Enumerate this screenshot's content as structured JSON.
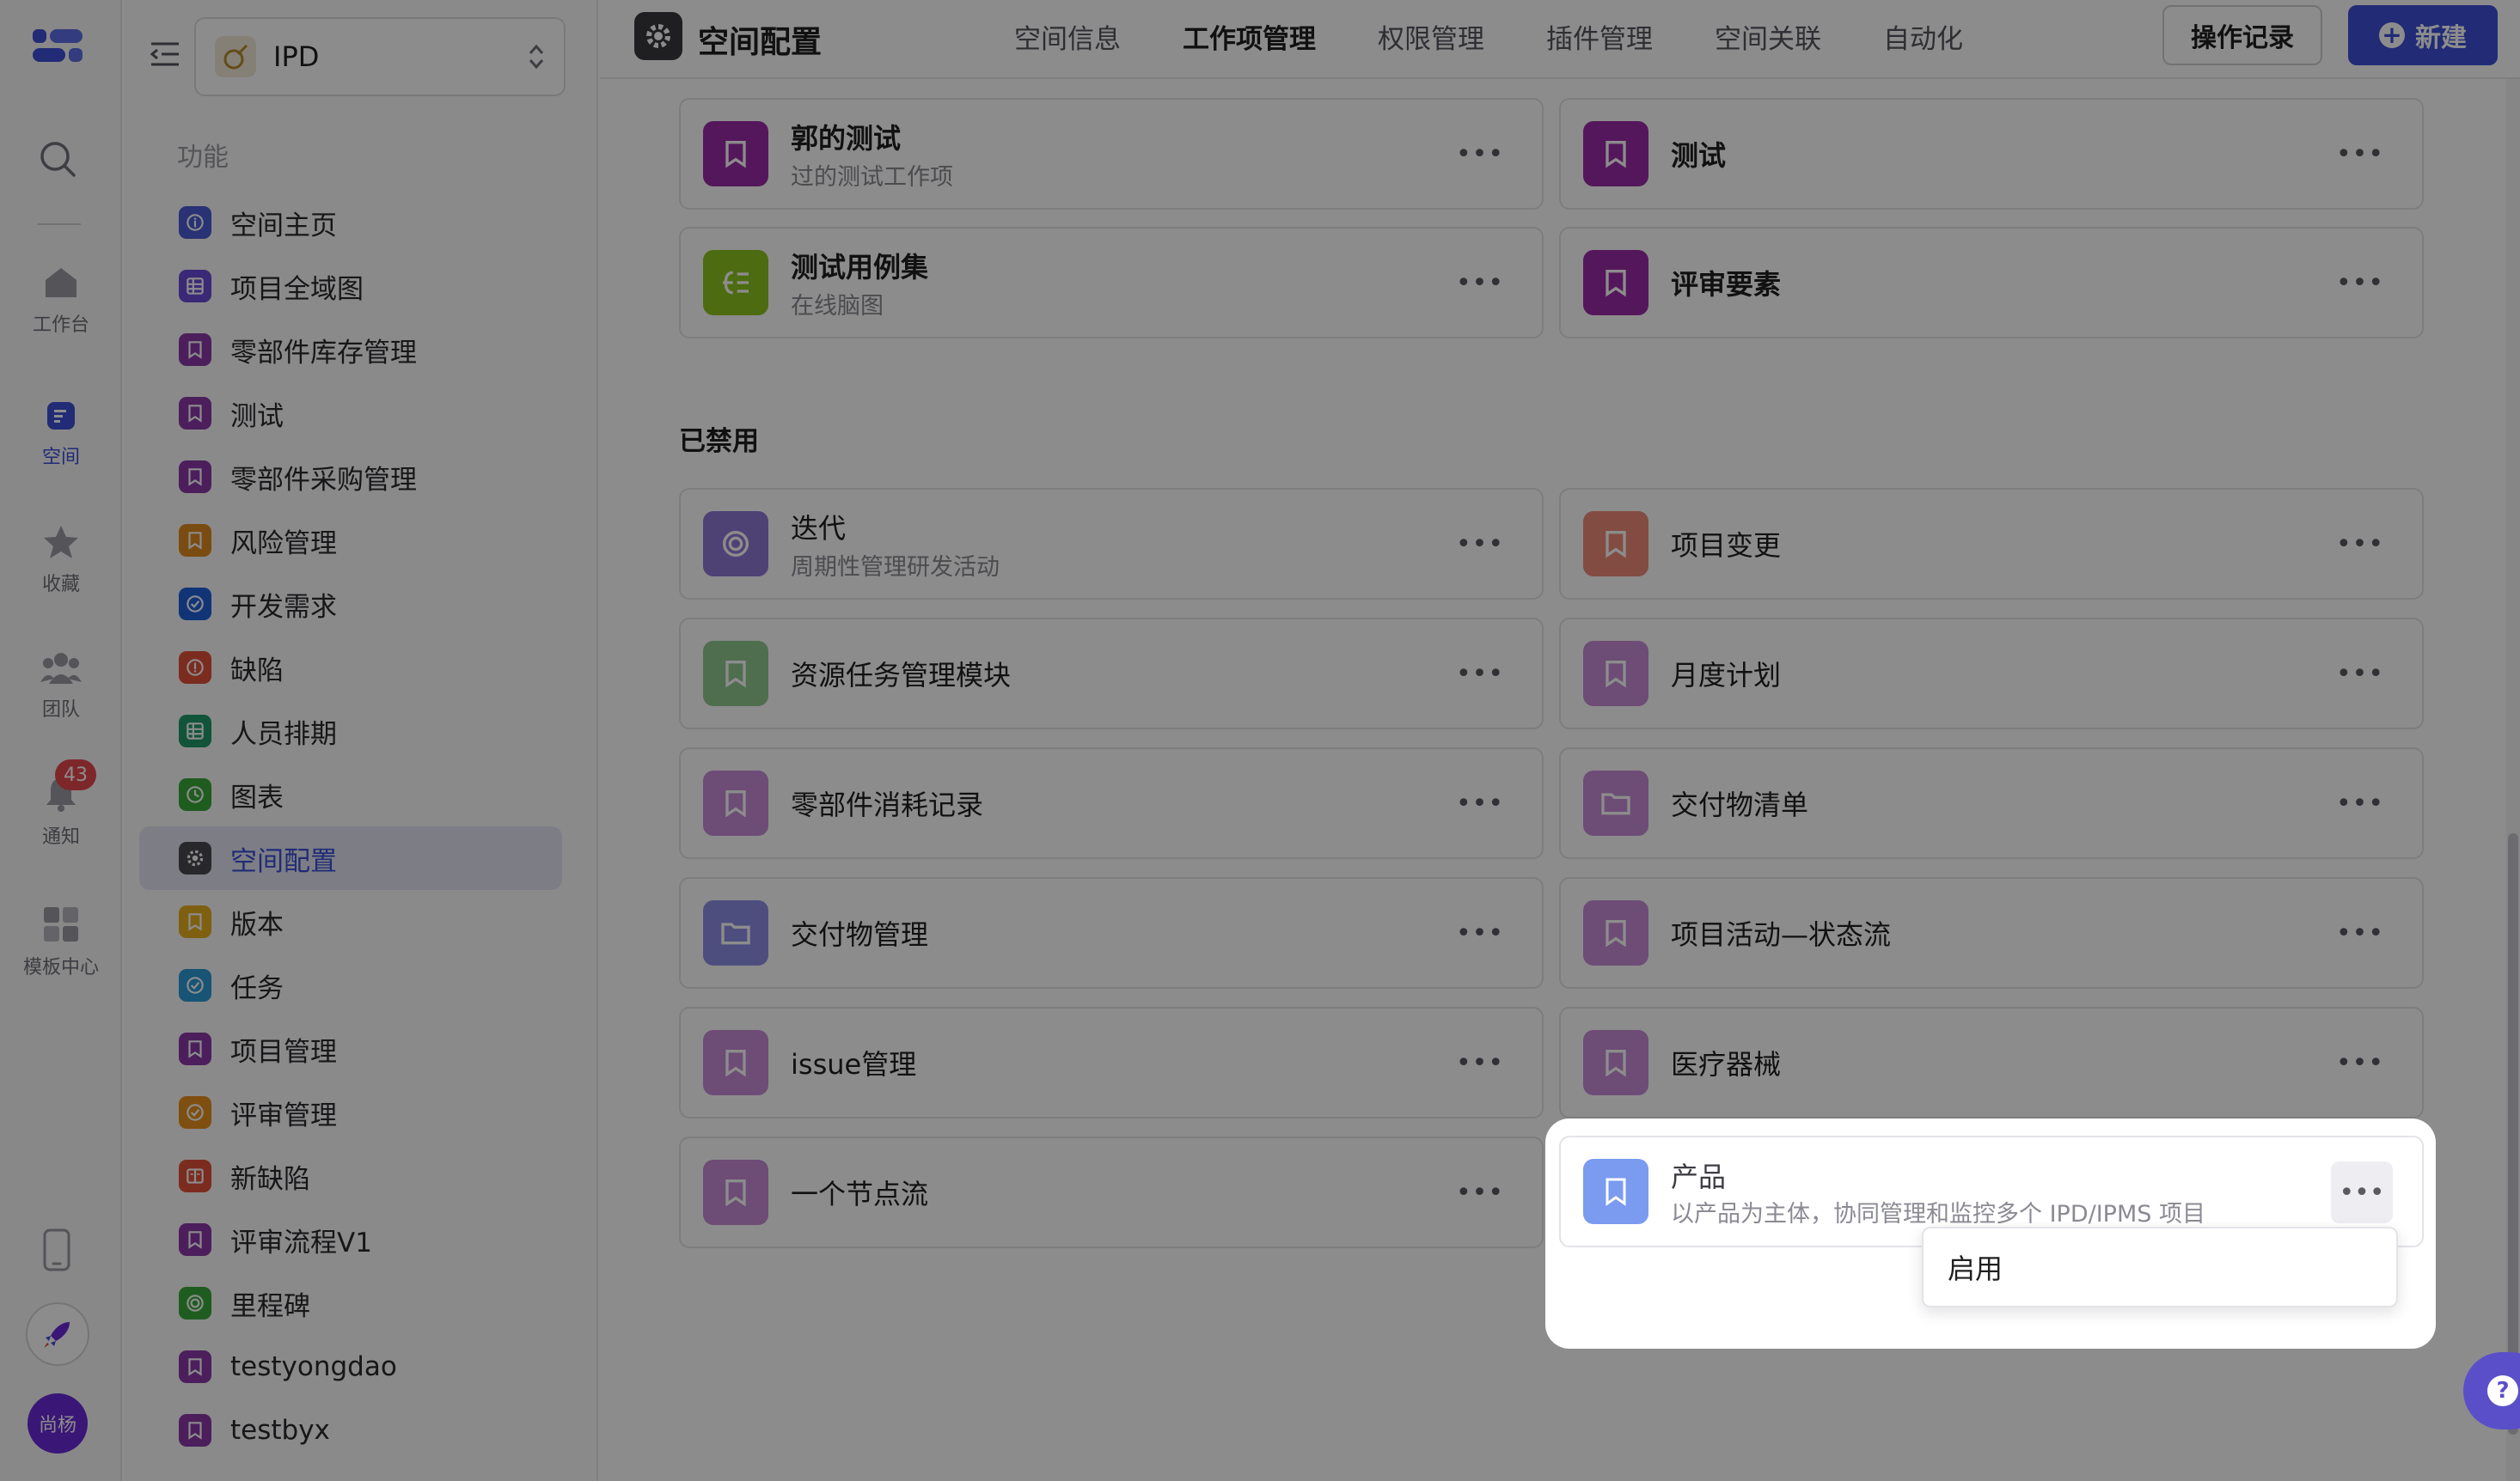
{
  "rail": {
    "items": [
      {
        "label": "工作台",
        "icon": "home-icon"
      },
      {
        "label": "空间",
        "icon": "space-icon"
      },
      {
        "label": "收藏",
        "icon": "star-icon"
      },
      {
        "label": "团队",
        "icon": "team-icon"
      },
      {
        "label": "通知",
        "icon": "bell-icon"
      },
      {
        "label": "模板中心",
        "icon": "template-icon"
      }
    ],
    "notification_count": "43",
    "avatar_text": "尚杨"
  },
  "sidebar": {
    "space_name": "IPD",
    "section_label": "功能",
    "items": [
      {
        "label": "空间主页",
        "color": "#4a5bd6",
        "icon": "info-icon"
      },
      {
        "label": "项目全域图",
        "color": "#6a4bd8",
        "icon": "grid-icon"
      },
      {
        "label": "零部件库存管理",
        "color": "#8a3aa8",
        "icon": "bookmark-icon"
      },
      {
        "label": "测试",
        "color": "#8a3aa8",
        "icon": "bookmark-icon"
      },
      {
        "label": "零部件采购管理",
        "color": "#8a3aa8",
        "icon": "bookmark-icon"
      },
      {
        "label": "风险管理",
        "color": "#e08a20",
        "icon": "bookmark-icon"
      },
      {
        "label": "开发需求",
        "color": "#1f5fd8",
        "icon": "check-circle-icon"
      },
      {
        "label": "缺陷",
        "color": "#e0503a",
        "icon": "alert-icon"
      },
      {
        "label": "人员排期",
        "color": "#1f9a6a",
        "icon": "table-icon"
      },
      {
        "label": "图表",
        "color": "#3aa83a",
        "icon": "clock-icon"
      },
      {
        "label": "空间配置",
        "color": "#4a4a50",
        "icon": "gear-icon"
      },
      {
        "label": "版本",
        "color": "#e8b020",
        "icon": "bookmark-icon"
      },
      {
        "label": "任务",
        "color": "#2a9ad8",
        "icon": "check-circle-icon"
      },
      {
        "label": "项目管理",
        "color": "#8a3aa8",
        "icon": "bookmark-icon"
      },
      {
        "label": "评审管理",
        "color": "#e89020",
        "icon": "check-circle-icon"
      },
      {
        "label": "新缺陷",
        "color": "#e0503a",
        "icon": "book-icon"
      },
      {
        "label": "评审流程V1",
        "color": "#8a3aa8",
        "icon": "bookmark-icon"
      },
      {
        "label": "里程碑",
        "color": "#3aa83a",
        "icon": "target-icon"
      },
      {
        "label": "testyongdao",
        "color": "#8a3aa8",
        "icon": "bookmark-icon"
      },
      {
        "label": "testbyx",
        "color": "#8a3aa8",
        "icon": "bookmark-icon"
      }
    ]
  },
  "header": {
    "title": "空间配置",
    "tabs": [
      "空间信息",
      "工作项管理",
      "权限管理",
      "插件管理",
      "空间关联",
      "自动化"
    ],
    "active_tab": "工作项管理",
    "log_button": "操作记录",
    "new_button": "新建"
  },
  "enabled_cards": [
    {
      "title": "郭的测试",
      "subtitle": "过的测试工作项",
      "color": "#9b2aa6",
      "icon": "bookmark-icon"
    },
    {
      "title": "测试",
      "subtitle": "",
      "color": "#9b2aa6",
      "icon": "bookmark-icon"
    },
    {
      "title": "测试用例集",
      "subtitle": "在线脑图",
      "color": "#8cc31e",
      "icon": "mindmap-icon"
    },
    {
      "title": "评审要素",
      "subtitle": "",
      "color": "#9b2aa6",
      "icon": "bookmark-icon"
    }
  ],
  "disabled_section_label": "已禁用",
  "disabled_cards": [
    {
      "title": "迭代",
      "subtitle": "周期性管理研发活动",
      "color": "#8e79d6",
      "icon": "target-icon"
    },
    {
      "title": "项目变更",
      "subtitle": "",
      "color": "#ef8a78",
      "icon": "bookmark-icon"
    },
    {
      "title": "资源任务管理模块",
      "subtitle": "",
      "color": "#8fc98f",
      "icon": "bookmark-icon"
    },
    {
      "title": "月度计划",
      "subtitle": "",
      "color": "#c68ad8",
      "icon": "bookmark-icon"
    },
    {
      "title": "零部件消耗记录",
      "subtitle": "",
      "color": "#c68ad8",
      "icon": "bookmark-icon"
    },
    {
      "title": "交付物清单",
      "subtitle": "",
      "color": "#c68ad8",
      "icon": "folder-icon"
    },
    {
      "title": "交付物管理",
      "subtitle": "",
      "color": "#8f8ee6",
      "icon": "folder-icon"
    },
    {
      "title": "项目活动—状态流",
      "subtitle": "",
      "color": "#c68ad8",
      "icon": "bookmark-icon"
    },
    {
      "title": "issue管理",
      "subtitle": "",
      "color": "#c68ad8",
      "icon": "bookmark-icon"
    },
    {
      "title": "医疗器械",
      "subtitle": "",
      "color": "#c68ad8",
      "icon": "bookmark-icon"
    },
    {
      "title": "一个节点流",
      "subtitle": "",
      "color": "#c68ad8",
      "icon": "bookmark-icon"
    }
  ],
  "highlight_card": {
    "title": "产品",
    "subtitle": "以产品为主体，协同管理和监控多个 IPD/IPMS 项目",
    "color": "#7b9bf0",
    "icon": "bookmark-icon"
  },
  "dropdown": {
    "option": "启用"
  },
  "more_glyph": "•••",
  "help_glyph": "?"
}
